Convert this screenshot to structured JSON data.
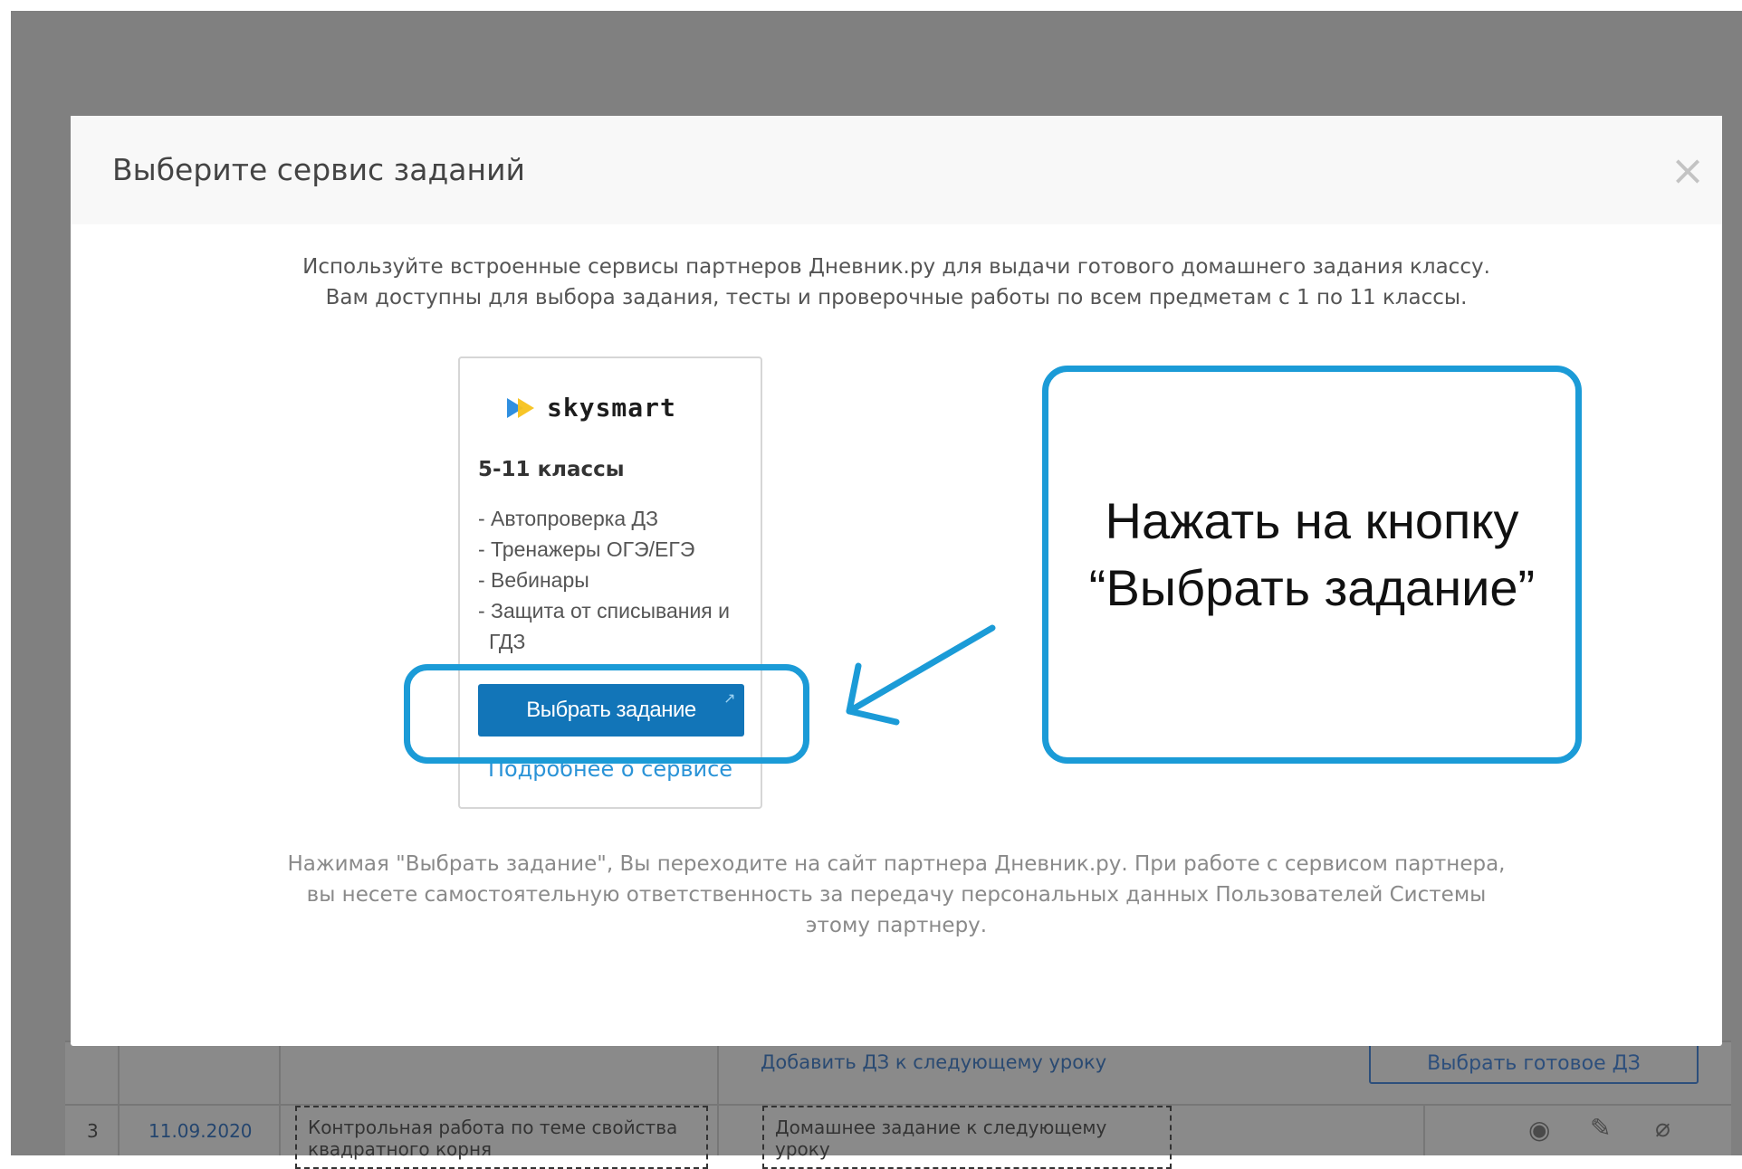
{
  "modal": {
    "title": "Выберите сервис заданий",
    "close_glyph": "×",
    "intro_line1": "Используйте встроенные сервисы партнеров Дневник.ру для выдачи готового домашнего задания классу.",
    "intro_line2": "Вам доступны для выбора задания, тесты и проверочные работы по всем предметам с 1 по 11 классы.",
    "disclaimer_line1": "Нажимая \"Выбрать задание\", Вы переходите на сайт партнера Дневник.ру. При работе с сервисом партнера,",
    "disclaimer_line2": "вы несете самостоятельную ответственность за передачу персональных данных Пользователей Системы",
    "disclaimer_line3": "этому партнеру."
  },
  "service_card": {
    "logo_text": "skysmart",
    "grades": "5-11 классы",
    "features": [
      "- Автопроверка ДЗ",
      "- Тренажеры ОГЭ/ЕГЭ",
      "- Вебинары",
      "- Защита от списывания и ГДЗ"
    ],
    "choose_button": "Выбрать задание",
    "external_glyph": "↗",
    "more_link": "Подробнее о сервисе"
  },
  "annotation": {
    "line1": "Нажать на кнопку",
    "line2": "“Выбрать задание”",
    "color": "#1b9bd7"
  },
  "background_table": {
    "add_hw_link": "Добавить ДЗ к следующему уроку",
    "choose_ready_button": "Выбрать готовое ДЗ",
    "row_number": "3",
    "row_date": "11.09.2020",
    "lesson_topic": "Контрольная работа по теме свойства квадратного корня",
    "homework": "Домашнее задание к следующему уроку"
  },
  "colors": {
    "overlay": "#808080",
    "primary_button": "#1275b8",
    "link": "#2a93d7"
  }
}
